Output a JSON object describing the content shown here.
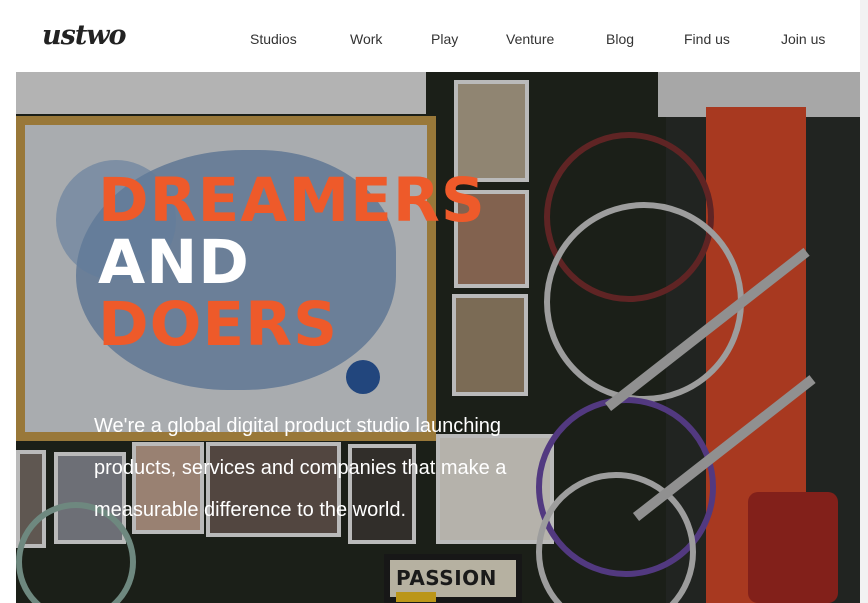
{
  "header": {
    "logo": "ustwo",
    "nav": [
      "Studios",
      "Work",
      "Play",
      "Venture",
      "Blog",
      "Find us",
      "Join us"
    ]
  },
  "hero": {
    "headline": [
      "DREAMERS",
      "AND",
      "DOERS"
    ],
    "headline_colors": [
      "#ee5a2a",
      "#ffffff",
      "#ee5a2a"
    ],
    "tagline_lines": [
      "We're a global digital product studio launching",
      "products, services and companies that make a",
      "measurable difference to the world."
    ],
    "poster_text": "PASSION"
  }
}
